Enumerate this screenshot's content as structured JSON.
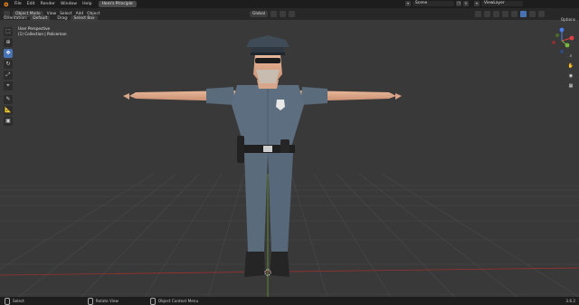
{
  "topbar": {
    "menus": [
      "File",
      "Edit",
      "Render",
      "Window",
      "Help"
    ],
    "workspace_tab": "Hero's Principle",
    "scene_label": "Scene",
    "view_layer_label": "ViewLayer"
  },
  "header": {
    "mode": "Object Mode",
    "menus": [
      "View",
      "Select",
      "Add",
      "Object"
    ],
    "transform_orientation": "Global"
  },
  "tool_settings": {
    "orientation_label": "Orientation:",
    "orientation_value": "Default",
    "drag_label": "Drag:",
    "drag_value": "Select Box",
    "options_label": "Options"
  },
  "viewport": {
    "view_name": "User Perspective",
    "collection_info": "(1) Collection | Policeman"
  },
  "toolbar": {
    "tools": [
      "select-box",
      "cursor",
      "move",
      "rotate",
      "scale",
      "transform",
      "annotate",
      "measure",
      "add-cube"
    ],
    "active_index": 2
  },
  "statusbar": {
    "select_label": "Select",
    "rotate_label": "Rotate View",
    "context_label": "Object Context Menu",
    "version": "3.6.2"
  },
  "colors": {
    "accent": "#4772b3",
    "grid_x_axis": "#9c3030",
    "grid_y_axis": "#6c9a2e",
    "uniform": "#5a6c7c"
  }
}
